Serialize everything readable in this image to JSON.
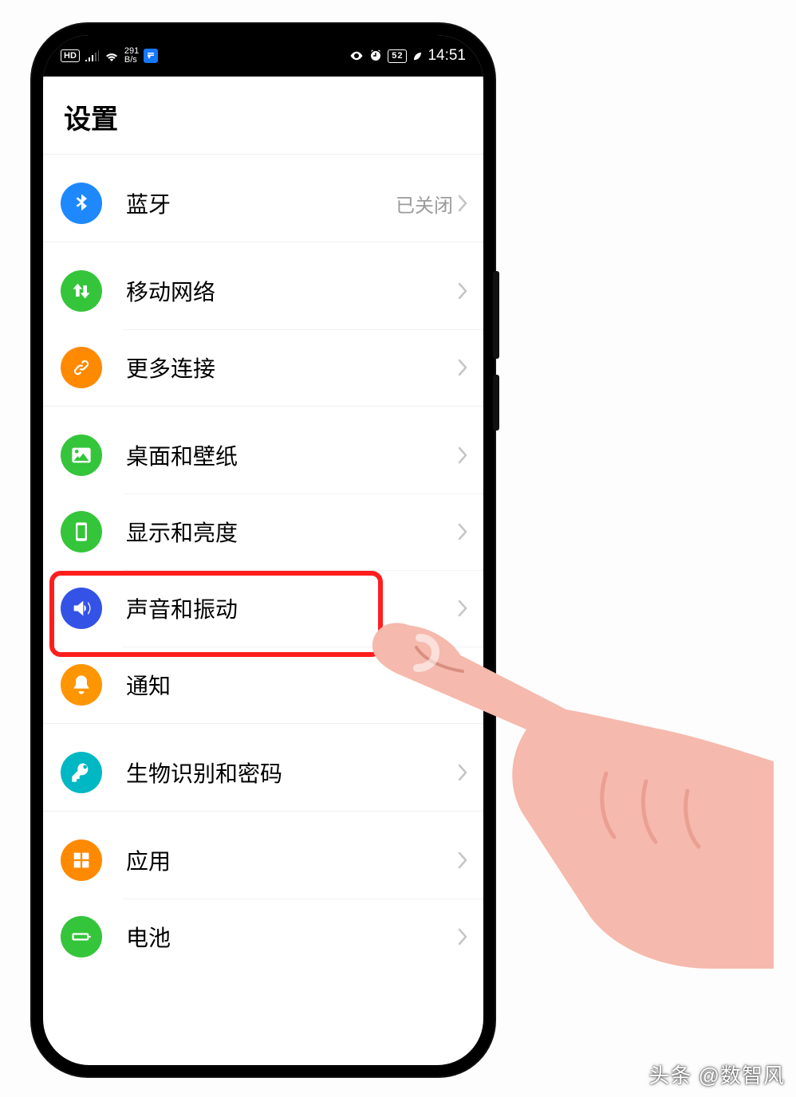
{
  "status": {
    "hd": "HD",
    "speed_top": "291",
    "speed_bot": "B/s",
    "battery": "52",
    "time": "14:51"
  },
  "title": "设置",
  "rows": [
    {
      "id": "bluetooth",
      "label": "蓝牙",
      "value": "已关闭",
      "color": "#1e88ff",
      "icon": "bluetooth"
    },
    {
      "id": "mobile",
      "label": "移动网络",
      "value": "",
      "color": "#34c53a",
      "icon": "updown"
    },
    {
      "id": "more-conn",
      "label": "更多连接",
      "value": "",
      "color": "#ff8a00",
      "icon": "link"
    },
    {
      "id": "wallpaper",
      "label": "桌面和壁纸",
      "value": "",
      "color": "#34c53a",
      "icon": "picture"
    },
    {
      "id": "display",
      "label": "显示和亮度",
      "value": "",
      "color": "#34c53a",
      "icon": "phone-rect"
    },
    {
      "id": "sound",
      "label": "声音和振动",
      "value": "",
      "color": "#3452e6",
      "icon": "sound"
    },
    {
      "id": "notify",
      "label": "通知",
      "value": "",
      "color": "#ff9500",
      "icon": "bell"
    },
    {
      "id": "biometric",
      "label": "生物识别和密码",
      "value": "",
      "color": "#00b8c4",
      "icon": "key"
    },
    {
      "id": "apps",
      "label": "应用",
      "value": "",
      "color": "#ff8a00",
      "icon": "grid"
    },
    {
      "id": "battery",
      "label": "电池",
      "value": "",
      "color": "#34c53a",
      "icon": "battery"
    }
  ],
  "group_breaks_after": [
    "bluetooth",
    "more-conn",
    "notify",
    "biometric"
  ],
  "highlight_row": "sound",
  "watermark": "头条 @数智风"
}
